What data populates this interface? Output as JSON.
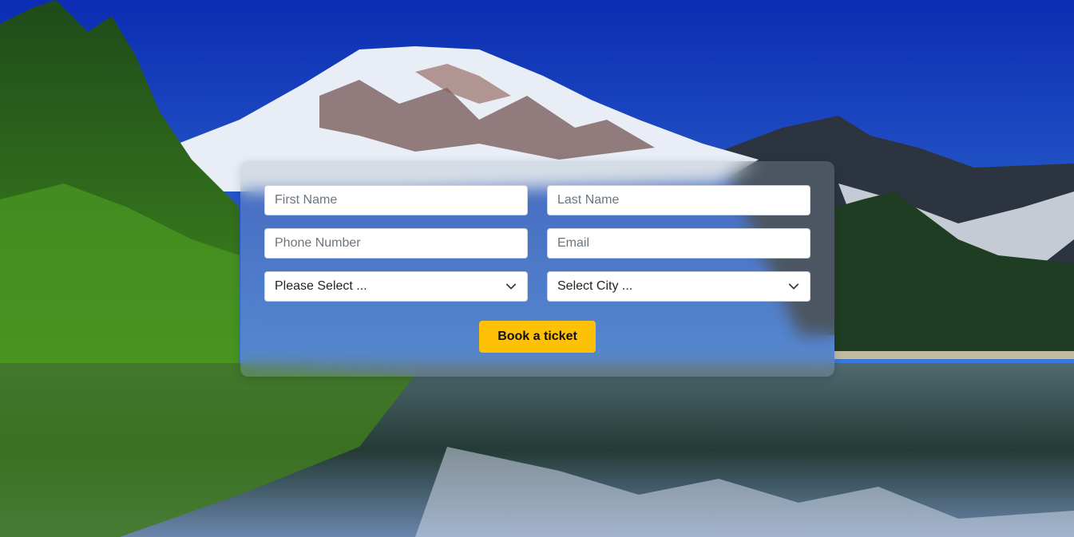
{
  "form": {
    "first_name": {
      "value": "",
      "placeholder": "First Name"
    },
    "last_name": {
      "value": "",
      "placeholder": "Last Name"
    },
    "phone": {
      "value": "",
      "placeholder": "Phone Number"
    },
    "email": {
      "value": "",
      "placeholder": "Email"
    },
    "select_one": {
      "selected": "Please Select ..."
    },
    "select_city": {
      "selected": "Select City ..."
    },
    "submit_label": "Book a ticket"
  },
  "icons": {
    "dropdown": "chevron-down-icon"
  },
  "colors": {
    "accent": "#ffc107",
    "sky": "#1a4fd4",
    "panel_overlay": "rgba(160,175,185,0.28)"
  }
}
